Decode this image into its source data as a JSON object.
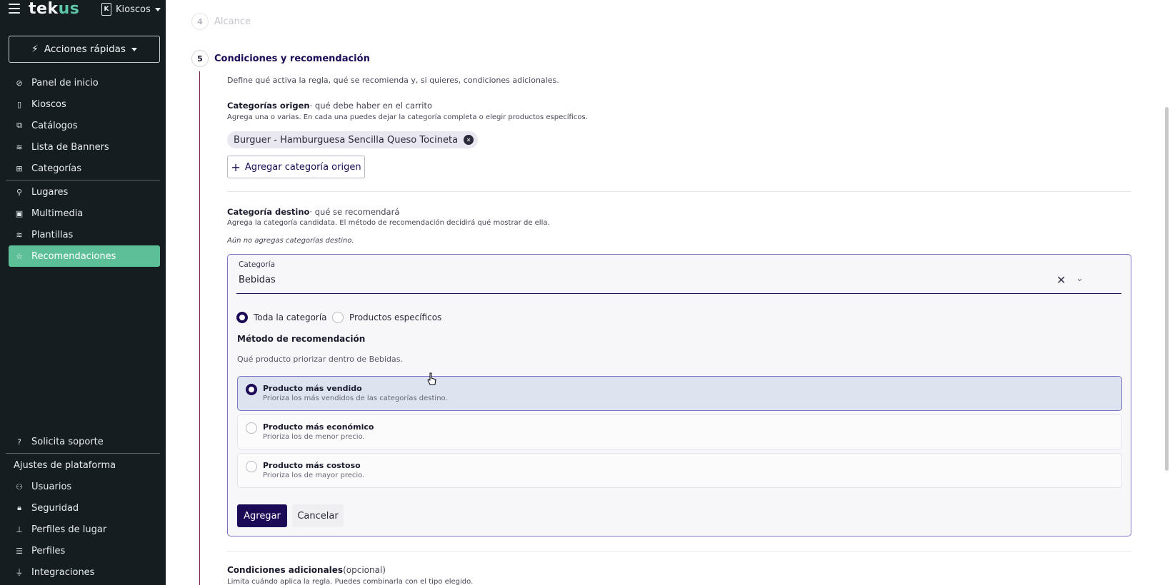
{
  "sidebar": {
    "logo": {
      "part1": "tek",
      "part2": "us"
    },
    "kiosk_selector": {
      "icon_letter": "K",
      "label": "Kioscos"
    },
    "quick_actions_label": "Acciones rápidas",
    "nav_primary": [
      {
        "label": "Panel de inicio",
        "icon": "dashboard-icon",
        "glyph": "⊘"
      },
      {
        "label": "Kioscos",
        "icon": "kiosk-icon",
        "glyph": "▯"
      },
      {
        "label": "Catálogos",
        "icon": "book-icon",
        "glyph": "⧉"
      },
      {
        "label": "Lista de Banners",
        "icon": "layers-icon",
        "glyph": "≋"
      },
      {
        "label": "Categorías",
        "icon": "categories-icon",
        "glyph": "⊞"
      }
    ],
    "nav_secondary": [
      {
        "label": "Lugares",
        "icon": "location-pin-icon",
        "glyph": "⚲"
      },
      {
        "label": "Multimedia",
        "icon": "image-icon",
        "glyph": "▣"
      },
      {
        "label": "Plantillas",
        "icon": "layers-icon",
        "glyph": "≋"
      },
      {
        "label": "Recomendaciones",
        "icon": "star-icon",
        "glyph": "☆",
        "active": true
      }
    ],
    "support_label": "Solicita soporte",
    "platform_heading": "Ajustes de plataforma",
    "nav_platform": [
      {
        "label": "Usuarios",
        "icon": "users-icon",
        "glyph": "⚇"
      },
      {
        "label": "Seguridad",
        "icon": "lock-icon",
        "glyph": "🔒︎"
      },
      {
        "label": "Perfiles de lugar",
        "icon": "stamp-icon",
        "glyph": "⊥"
      },
      {
        "label": "Perfiles",
        "icon": "list-icon",
        "glyph": "☰"
      },
      {
        "label": "Integraciones",
        "icon": "plug-icon",
        "glyph": "⏚"
      }
    ]
  },
  "steps": {
    "prev": {
      "number": "4",
      "title": "Alcance"
    },
    "current": {
      "number": "5",
      "title": "Condiciones y recomendación"
    }
  },
  "section": {
    "intro": "Define qué activa la regla, qué se recomienda y, si quieres, condiciones adicionales.",
    "origin": {
      "title": "Categorías origen",
      "title_suffix": "· qué debe haber en el carrito",
      "hint": "Agrega una o varias. En cada una puedes dejar la categoría completa o elegir productos específicos.",
      "chip": "Burguer - Hamburguesa Sencilla Queso Tocineta",
      "add_button": "Agregar categoría origen"
    },
    "destination": {
      "title": "Categoría destino",
      "title_suffix": "· qué se recomendará",
      "hint": "Agrega la categoría candidata. El método de recomendación decidirá qué mostrar de ella.",
      "empty_note": "Aún no agregas categorías destino.",
      "field_label": "Categoría",
      "field_value": "Bebidas",
      "scope_all": "Toda la categoría",
      "scope_specific": "Productos específicos",
      "method_title": "Método de recomendación",
      "method_desc": "Qué producto priorizar dentro de Bebidas.",
      "options": [
        {
          "title": "Producto más vendido",
          "sub": "Prioriza los más vendidos de las categorías destino."
        },
        {
          "title": "Producto más económico",
          "sub": "Prioriza los de menor precio."
        },
        {
          "title": "Producto más costoso",
          "sub": "Prioriza los de mayor precio."
        }
      ],
      "add_button": "Agregar",
      "cancel_button": "Cancelar"
    },
    "additional": {
      "title": "Condiciones adicionales",
      "title_suffix": "(opcional)",
      "hint": "Limita cuándo aplica la regla. Puedes combinarla con el tipo elegido."
    }
  },
  "colors": {
    "sidebar_bg": "#161d21",
    "active_nav": "#5cbf98",
    "primary": "#1c0a56",
    "panel_border": "#7b74c4"
  }
}
